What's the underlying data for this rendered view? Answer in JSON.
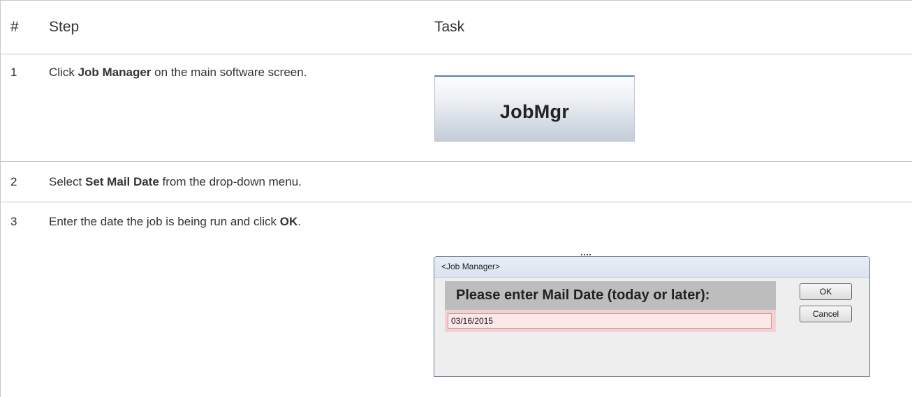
{
  "table": {
    "headers": {
      "number": "#",
      "step": "Step",
      "task": "Task"
    },
    "rows": [
      {
        "number": "1",
        "step_before": "Click ",
        "step_bold": "Job Manager",
        "step_after": " on the main software screen."
      },
      {
        "number": "2",
        "step_before": "Select ",
        "step_bold": "Set Mail Date",
        "step_after": " from the drop-down menu."
      },
      {
        "number": "3",
        "step_before": "Enter the date the job is being run and click ",
        "step_bold": "OK",
        "step_after": "."
      }
    ]
  },
  "jobmgr_button": {
    "label": "JobMgr"
  },
  "dialog": {
    "title": "<Job Manager>",
    "heading": "Please enter Mail Date (today or later):",
    "date_value": "03/16/2015",
    "ok_label": "OK",
    "cancel_label": "Cancel"
  },
  "colors": {
    "border": "#c8c8c8",
    "text": "#333333",
    "input_background": "#fde8e8",
    "heading_background": "#bdbdbd"
  }
}
